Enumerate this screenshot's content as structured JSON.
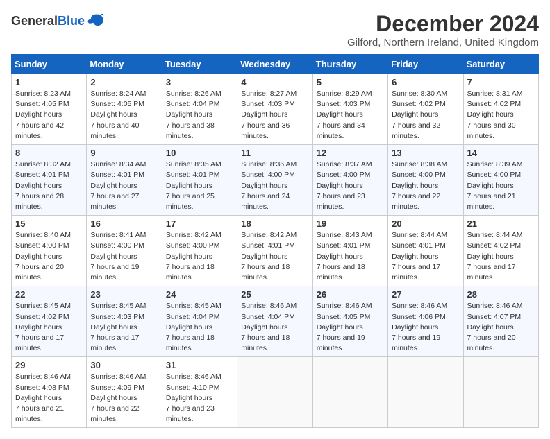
{
  "header": {
    "logo_general": "General",
    "logo_blue": "Blue",
    "month_title": "December 2024",
    "location": "Gilford, Northern Ireland, United Kingdom"
  },
  "weekdays": [
    "Sunday",
    "Monday",
    "Tuesday",
    "Wednesday",
    "Thursday",
    "Friday",
    "Saturday"
  ],
  "weeks": [
    [
      {
        "day": "1",
        "sunrise": "8:23 AM",
        "sunset": "4:05 PM",
        "daylight": "7 hours and 42 minutes."
      },
      {
        "day": "2",
        "sunrise": "8:24 AM",
        "sunset": "4:05 PM",
        "daylight": "7 hours and 40 minutes."
      },
      {
        "day": "3",
        "sunrise": "8:26 AM",
        "sunset": "4:04 PM",
        "daylight": "7 hours and 38 minutes."
      },
      {
        "day": "4",
        "sunrise": "8:27 AM",
        "sunset": "4:03 PM",
        "daylight": "7 hours and 36 minutes."
      },
      {
        "day": "5",
        "sunrise": "8:29 AM",
        "sunset": "4:03 PM",
        "daylight": "7 hours and 34 minutes."
      },
      {
        "day": "6",
        "sunrise": "8:30 AM",
        "sunset": "4:02 PM",
        "daylight": "7 hours and 32 minutes."
      },
      {
        "day": "7",
        "sunrise": "8:31 AM",
        "sunset": "4:02 PM",
        "daylight": "7 hours and 30 minutes."
      }
    ],
    [
      {
        "day": "8",
        "sunrise": "8:32 AM",
        "sunset": "4:01 PM",
        "daylight": "7 hours and 28 minutes."
      },
      {
        "day": "9",
        "sunrise": "8:34 AM",
        "sunset": "4:01 PM",
        "daylight": "7 hours and 27 minutes."
      },
      {
        "day": "10",
        "sunrise": "8:35 AM",
        "sunset": "4:01 PM",
        "daylight": "7 hours and 25 minutes."
      },
      {
        "day": "11",
        "sunrise": "8:36 AM",
        "sunset": "4:00 PM",
        "daylight": "7 hours and 24 minutes."
      },
      {
        "day": "12",
        "sunrise": "8:37 AM",
        "sunset": "4:00 PM",
        "daylight": "7 hours and 23 minutes."
      },
      {
        "day": "13",
        "sunrise": "8:38 AM",
        "sunset": "4:00 PM",
        "daylight": "7 hours and 22 minutes."
      },
      {
        "day": "14",
        "sunrise": "8:39 AM",
        "sunset": "4:00 PM",
        "daylight": "7 hours and 21 minutes."
      }
    ],
    [
      {
        "day": "15",
        "sunrise": "8:40 AM",
        "sunset": "4:00 PM",
        "daylight": "7 hours and 20 minutes."
      },
      {
        "day": "16",
        "sunrise": "8:41 AM",
        "sunset": "4:00 PM",
        "daylight": "7 hours and 19 minutes."
      },
      {
        "day": "17",
        "sunrise": "8:42 AM",
        "sunset": "4:00 PM",
        "daylight": "7 hours and 18 minutes."
      },
      {
        "day": "18",
        "sunrise": "8:42 AM",
        "sunset": "4:01 PM",
        "daylight": "7 hours and 18 minutes."
      },
      {
        "day": "19",
        "sunrise": "8:43 AM",
        "sunset": "4:01 PM",
        "daylight": "7 hours and 18 minutes."
      },
      {
        "day": "20",
        "sunrise": "8:44 AM",
        "sunset": "4:01 PM",
        "daylight": "7 hours and 17 minutes."
      },
      {
        "day": "21",
        "sunrise": "8:44 AM",
        "sunset": "4:02 PM",
        "daylight": "7 hours and 17 minutes."
      }
    ],
    [
      {
        "day": "22",
        "sunrise": "8:45 AM",
        "sunset": "4:02 PM",
        "daylight": "7 hours and 17 minutes."
      },
      {
        "day": "23",
        "sunrise": "8:45 AM",
        "sunset": "4:03 PM",
        "daylight": "7 hours and 17 minutes."
      },
      {
        "day": "24",
        "sunrise": "8:45 AM",
        "sunset": "4:04 PM",
        "daylight": "7 hours and 18 minutes."
      },
      {
        "day": "25",
        "sunrise": "8:46 AM",
        "sunset": "4:04 PM",
        "daylight": "7 hours and 18 minutes."
      },
      {
        "day": "26",
        "sunrise": "8:46 AM",
        "sunset": "4:05 PM",
        "daylight": "7 hours and 19 minutes."
      },
      {
        "day": "27",
        "sunrise": "8:46 AM",
        "sunset": "4:06 PM",
        "daylight": "7 hours and 19 minutes."
      },
      {
        "day": "28",
        "sunrise": "8:46 AM",
        "sunset": "4:07 PM",
        "daylight": "7 hours and 20 minutes."
      }
    ],
    [
      {
        "day": "29",
        "sunrise": "8:46 AM",
        "sunset": "4:08 PM",
        "daylight": "7 hours and 21 minutes."
      },
      {
        "day": "30",
        "sunrise": "8:46 AM",
        "sunset": "4:09 PM",
        "daylight": "7 hours and 22 minutes."
      },
      {
        "day": "31",
        "sunrise": "8:46 AM",
        "sunset": "4:10 PM",
        "daylight": "7 hours and 23 minutes."
      },
      null,
      null,
      null,
      null
    ]
  ]
}
